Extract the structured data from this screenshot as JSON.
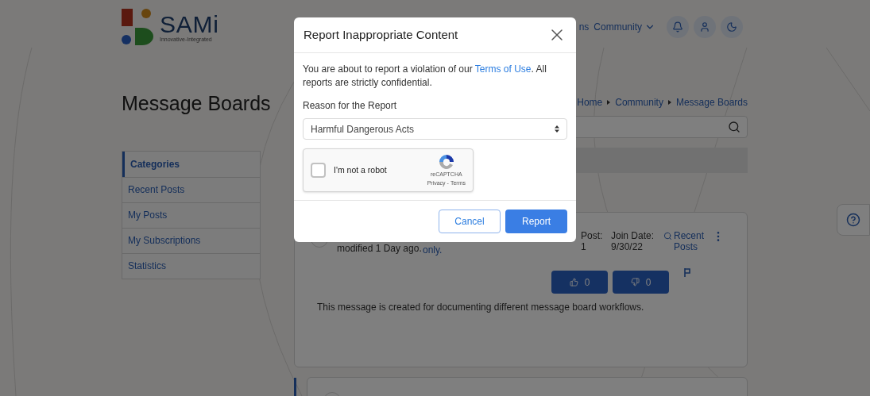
{
  "header": {
    "logo": {
      "name": "SAMi",
      "tagline": "Innovative-Integrated"
    },
    "nav": [
      {
        "label": "ns",
        "kind": "link"
      },
      {
        "label": "Community",
        "kind": "dropdown"
      }
    ]
  },
  "page": {
    "title": "Message Boards"
  },
  "breadcrumb": [
    "Home",
    "Community",
    "Message Boards"
  ],
  "sidebar": {
    "items": [
      {
        "label": "Categories",
        "selected": true
      },
      {
        "label": "Recent Posts",
        "selected": false
      },
      {
        "label": "My Posts",
        "selected": false
      },
      {
        "label": "My Subscriptions",
        "selected": false
      },
      {
        "label": "Statistics",
        "selected": false
      }
    ]
  },
  "post": {
    "modified": "modified 1 Day ago.",
    "title_tail": "only.",
    "stats": [
      {
        "label": "Post:",
        "value": "1"
      },
      {
        "label": "Join Date:",
        "value": "9/30/22"
      }
    ],
    "recent_posts": "Recent Posts",
    "likes": "0",
    "dislikes": "0",
    "body": "This message is created for documenting different message board workflows."
  },
  "dialog": {
    "title": "Report Inappropriate Content",
    "message": "You are about to report a violation of our ",
    "link": "Terms of Use",
    "message_end": ". All reports are strictly confidential.",
    "reason_label": "Reason for the Report",
    "reason_value": "Harmful Dangerous Acts",
    "captcha": {
      "label": "I'm not a robot",
      "checked": false,
      "brand": "reCAPTCHA",
      "privacy": "Privacy",
      "sep": "-",
      "terms": "Terms"
    },
    "buttons": [
      {
        "label": "Cancel",
        "kind": "secondary"
      },
      {
        "label": "Report",
        "kind": "primary"
      }
    ]
  }
}
